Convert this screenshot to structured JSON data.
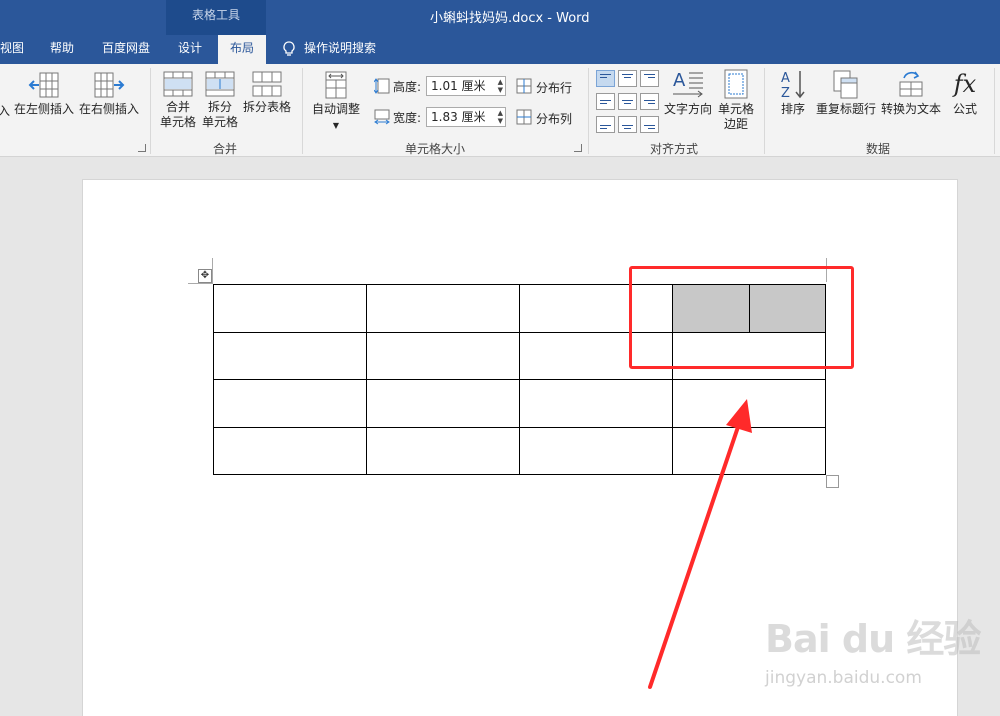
{
  "title_bar": {
    "tools_label": "表格工具",
    "document_title": "小蝌蚪找妈妈.docx  -  Word"
  },
  "tabs": [
    {
      "label": "视图"
    },
    {
      "label": "帮助"
    },
    {
      "label": "百度网盘"
    },
    {
      "label": "设计"
    },
    {
      "label": "布局"
    }
  ],
  "tell_me": "操作说明搜索",
  "ribbon": {
    "rows_cols": {
      "insert_truncated": "入",
      "insert_left": "在左侧插入",
      "insert_right": "在右侧插入"
    },
    "merge": {
      "merge_cells_1": "合并",
      "merge_cells_2": "单元格",
      "split_cells_1": "拆分",
      "split_cells_2": "单元格",
      "split_table": "拆分表格",
      "group": "合并"
    },
    "cell_size": {
      "autofit": "自动调整",
      "height_label": "高度:",
      "height_value": "1.01 厘米",
      "width_label": "宽度:",
      "width_value": "1.83 厘米",
      "distribute_rows": "分布行",
      "distribute_cols": "分布列",
      "group": "单元格大小"
    },
    "alignment": {
      "text_direction": "文字方向",
      "cell_margins_1": "单元格",
      "cell_margins_2": "边距",
      "group": "对齐方式"
    },
    "data": {
      "sort": "排序",
      "repeat_header": "重复标题行",
      "convert_to_text": "转换为文本",
      "formula": "公式",
      "formula_icon_text": "fx",
      "group": "数据"
    }
  },
  "watermark": {
    "main": "Bai du 经验",
    "sub": "jingyan.baidu.com"
  },
  "colors": {
    "title_bar": "#2b579a",
    "highlight": "#ff2a2a",
    "shaded_cell": "#c8c8c8"
  }
}
